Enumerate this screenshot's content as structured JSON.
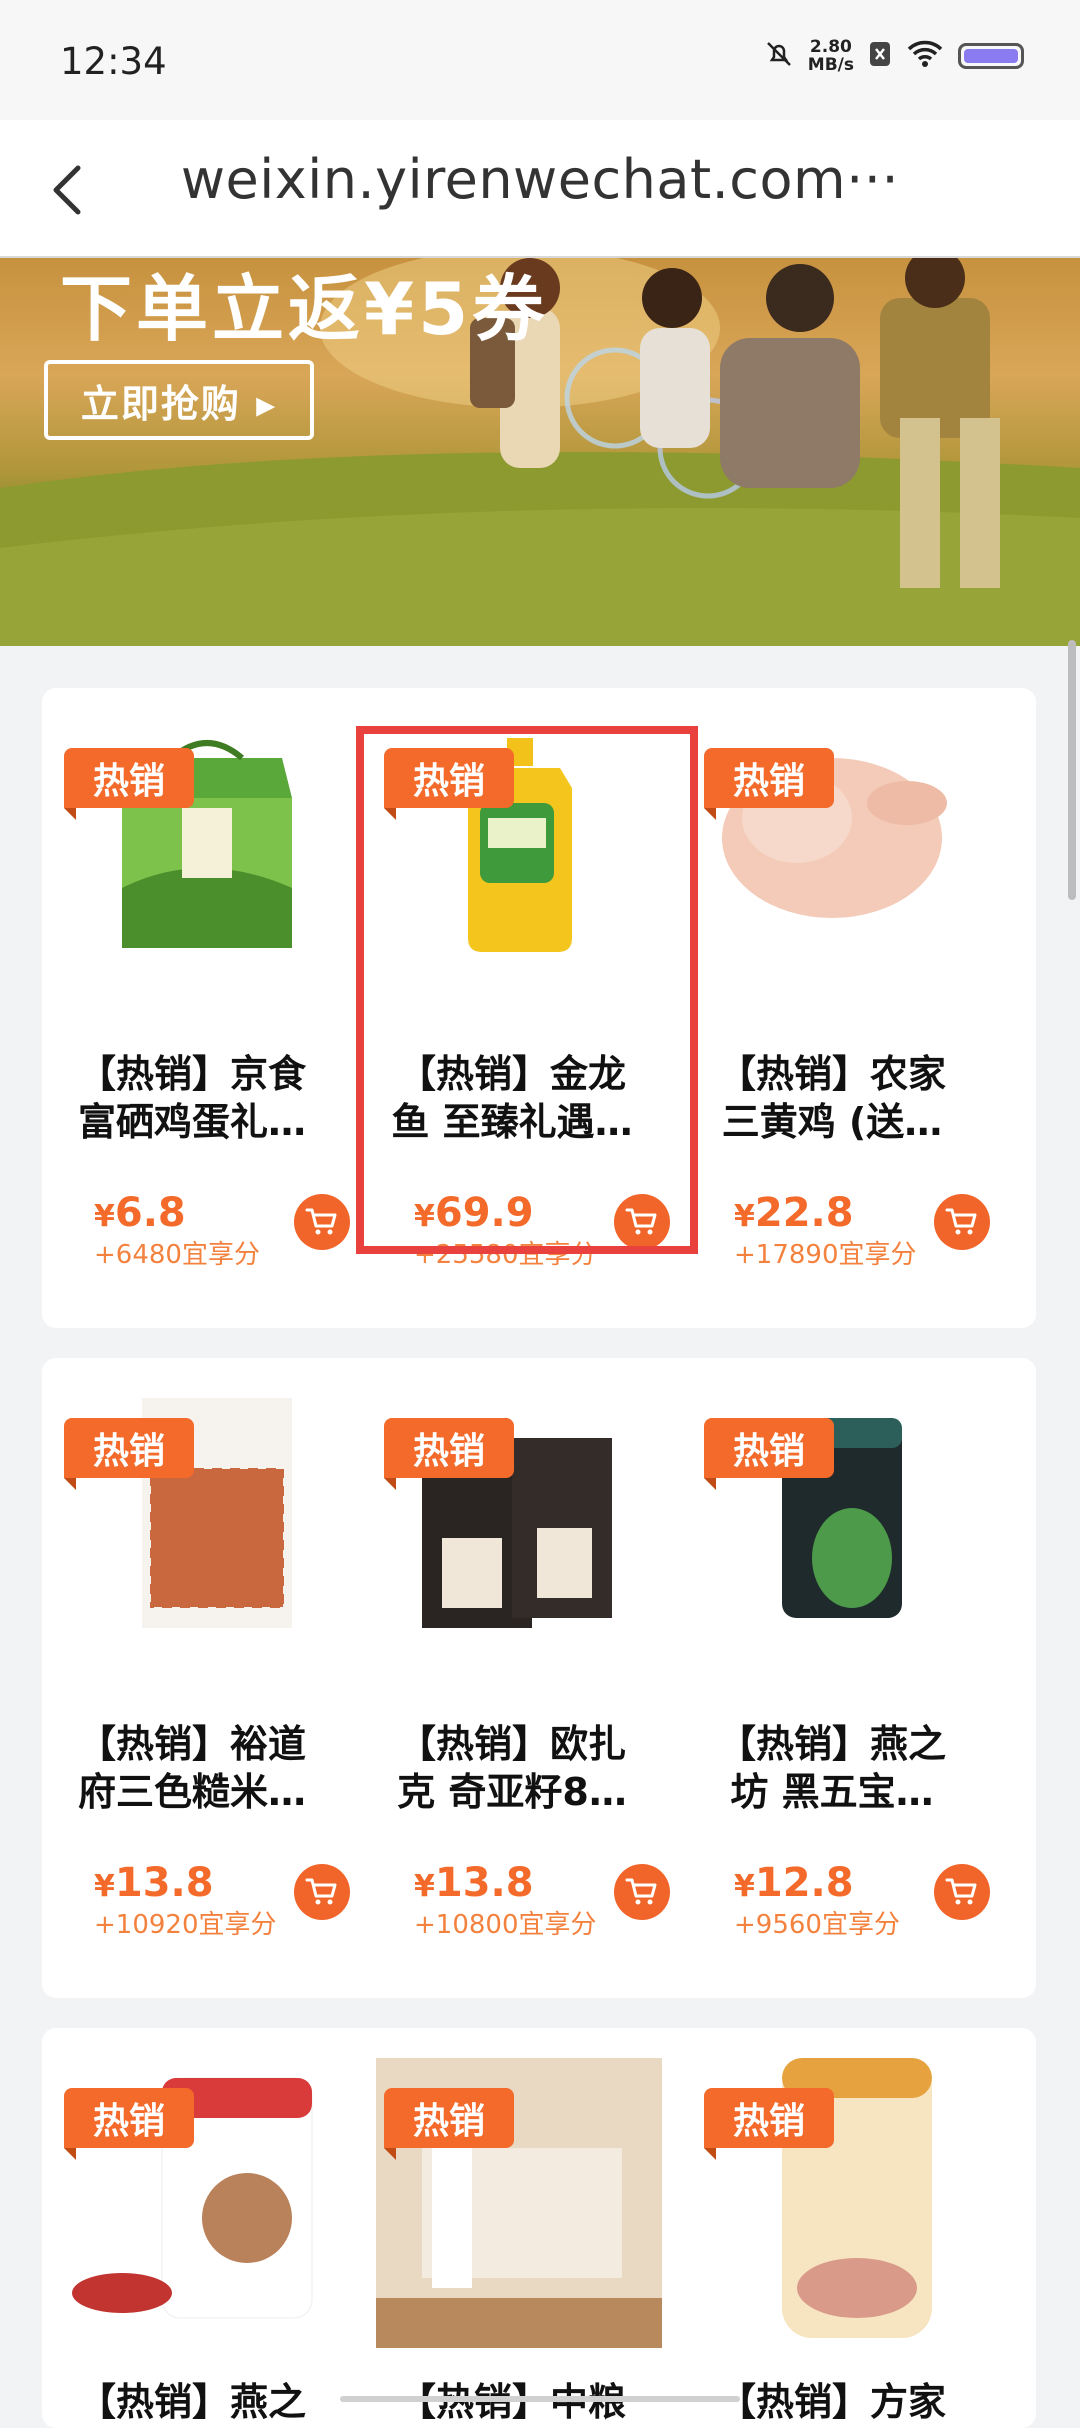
{
  "status_bar": {
    "time": "12:34",
    "speed_value": "2.80",
    "speed_unit": "MB/s"
  },
  "nav": {
    "title": "weixin.yirenwechat.com···"
  },
  "banner": {
    "title": "下单立返¥5券",
    "button_label": "立即抢购 ▸"
  },
  "badge_label": "热销",
  "products": [
    {
      "name_line1": "【热销】京食",
      "name_line2": "富硒鸡蛋礼…",
      "currency": "¥",
      "price": "6.8",
      "points": "+6480宜享分"
    },
    {
      "name_line1": "【热销】金龙",
      "name_line2": "鱼 至臻礼遇…",
      "currency": "¥",
      "price": "69.9",
      "points": "+25580宜享分"
    },
    {
      "name_line1": "【热销】农家",
      "name_line2": "三黄鸡 (送…",
      "currency": "¥",
      "price": "22.8",
      "points": "+17890宜享分"
    },
    {
      "name_line1": "【热销】裕道",
      "name_line2": "府三色糙米…",
      "currency": "¥",
      "price": "13.8",
      "points": "+10920宜享分"
    },
    {
      "name_line1": "【热销】欧扎",
      "name_line2": "克 奇亚籽8…",
      "currency": "¥",
      "price": "13.8",
      "points": "+10800宜享分"
    },
    {
      "name_line1": "【热销】燕之",
      "name_line2": "坊 黑五宝…",
      "currency": "¥",
      "price": "12.8",
      "points": "+9560宜享分"
    },
    {
      "name_line1": "【热销】燕之",
      "name_line2": "",
      "currency": "",
      "price": "",
      "points": ""
    },
    {
      "name_line1": "【热销】中粮",
      "name_line2": "",
      "currency": "",
      "price": "",
      "points": ""
    },
    {
      "name_line1": "【热销】方家",
      "name_line2": "",
      "currency": "",
      "price": "",
      "points": ""
    }
  ],
  "colors": {
    "accent": "#f46a2a",
    "highlight_border": "#e8413e"
  },
  "icons": [
    "back-arrow-icon",
    "mute-icon",
    "wifi-icon",
    "battery-icon",
    "cart-icon"
  ]
}
